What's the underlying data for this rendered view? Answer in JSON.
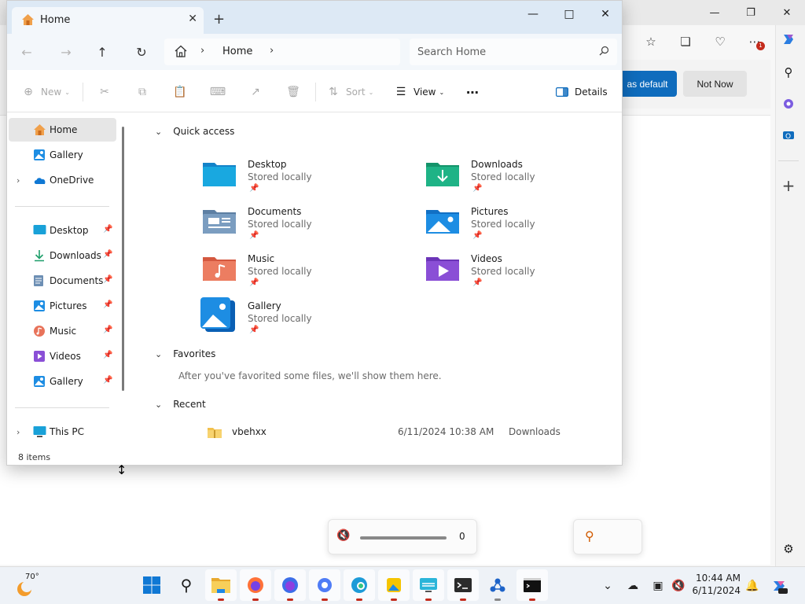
{
  "browser": {
    "banner": {
      "set_default_label": "as default",
      "not_now_label": "Not Now"
    },
    "volume": {
      "value": "0",
      "level": 0
    },
    "notification_badge": "1"
  },
  "explorer": {
    "tab": {
      "title": "Home"
    },
    "address": {
      "crumb": "Home"
    },
    "search": {
      "placeholder": "Search Home"
    },
    "commands": {
      "new": "New",
      "sort": "Sort",
      "view": "View",
      "details": "Details"
    },
    "sidebar": {
      "top_items": [
        {
          "label": "Home"
        },
        {
          "label": "Gallery"
        },
        {
          "label": "OneDrive"
        }
      ],
      "pinned_items": [
        {
          "label": "Desktop"
        },
        {
          "label": "Downloads"
        },
        {
          "label": "Documents"
        },
        {
          "label": "Pictures"
        },
        {
          "label": "Music"
        },
        {
          "label": "Videos"
        },
        {
          "label": "Gallery"
        }
      ],
      "bottom_items": [
        {
          "label": "This PC"
        }
      ]
    },
    "quick_access": {
      "header": "Quick access",
      "items": [
        {
          "name": "Desktop",
          "sub": "Stored locally"
        },
        {
          "name": "Downloads",
          "sub": "Stored locally"
        },
        {
          "name": "Documents",
          "sub": "Stored locally"
        },
        {
          "name": "Pictures",
          "sub": "Stored locally"
        },
        {
          "name": "Music",
          "sub": "Stored locally"
        },
        {
          "name": "Videos",
          "sub": "Stored locally"
        },
        {
          "name": "Gallery",
          "sub": "Stored locally"
        }
      ]
    },
    "favorites": {
      "header": "Favorites",
      "empty_text": "After you've favorited some files, we'll show them here."
    },
    "recent": {
      "header": "Recent",
      "items": [
        {
          "name": "vbehxx",
          "date": "6/11/2024 10:38 AM",
          "location": "Downloads"
        }
      ]
    },
    "status": "8 items"
  },
  "taskbar": {
    "weather_temp": "70°",
    "clock_time": "10:44 AM",
    "clock_date": "6/11/2024",
    "accent": "#0f6cbd"
  }
}
